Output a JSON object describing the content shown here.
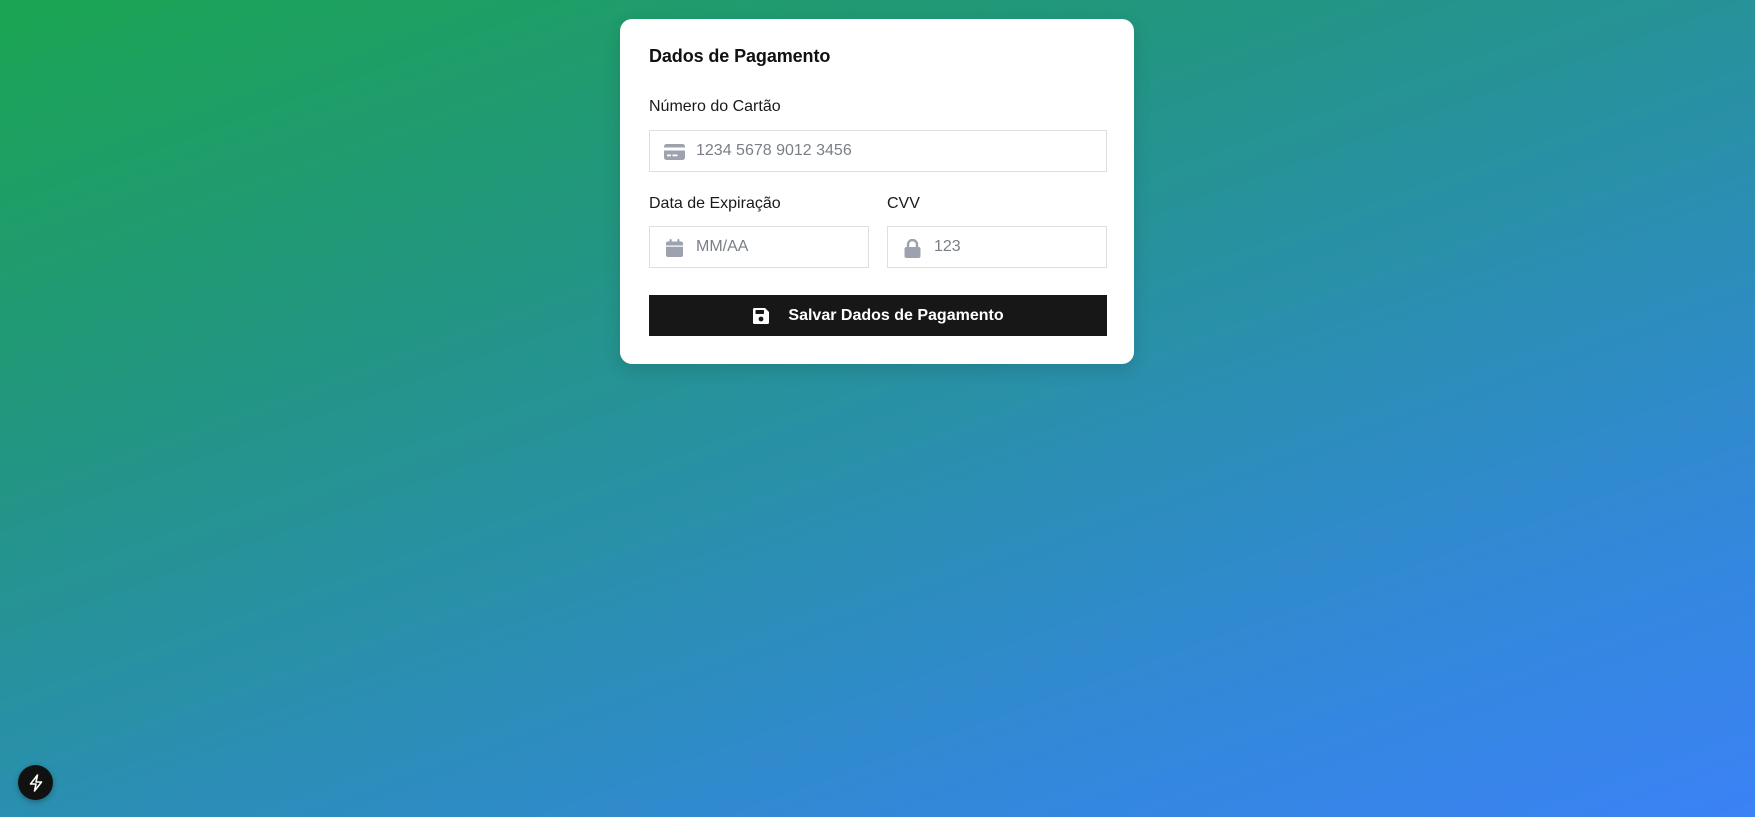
{
  "form": {
    "title": "Dados de Pagamento",
    "card_number": {
      "label": "Número do Cartão",
      "placeholder": "1234 5678 9012 3456",
      "value": "",
      "icon": "credit-card-icon"
    },
    "expiry": {
      "label": "Data de Expiração",
      "placeholder": "MM/AA",
      "value": "",
      "icon": "calendar-icon"
    },
    "cvv": {
      "label": "CVV",
      "placeholder": "123",
      "value": "",
      "icon": "lock-icon"
    },
    "save_button": {
      "label": "Salvar Dados de Pagamento",
      "icon": "floppy-disk-icon"
    }
  },
  "floating_button": {
    "icon": "lightning-bolt-icon"
  },
  "colors": {
    "background_gradient_start": "#1ba552",
    "background_gradient_end": "#3b82f6",
    "button_bg": "#171717",
    "icon_gray": "#9ca3af"
  }
}
